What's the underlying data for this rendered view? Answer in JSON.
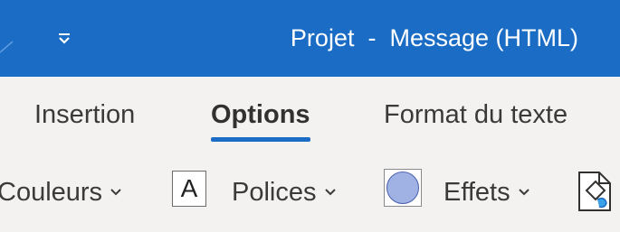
{
  "titlebar": {
    "title": "Projet  -  Message (HTML)",
    "background_color": "#1a6cc4",
    "customize_icon": "chevron-down-with-bar-icon"
  },
  "tabs": [
    {
      "label": "Insertion",
      "active": false
    },
    {
      "label": "Options",
      "active": true
    },
    {
      "label": "Format du texte",
      "active": false
    }
  ],
  "ribbon": {
    "colors_label": "Couleurs",
    "font_swatch_letter": "A",
    "fonts_label": "Polices",
    "effects_label": "Effets",
    "page_color_icon": "page-color-icon"
  }
}
